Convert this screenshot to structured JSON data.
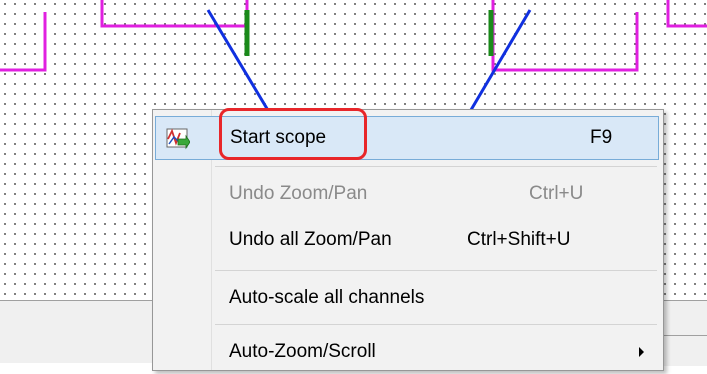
{
  "menu": {
    "items": [
      {
        "label": "Start scope",
        "shortcut": "F9",
        "enabled": true,
        "highlighted": true,
        "icon": "scope-start-icon"
      },
      {
        "label": "Undo Zoom/Pan",
        "shortcut": "Ctrl+U",
        "enabled": false
      },
      {
        "label": "Undo all Zoom/Pan",
        "shortcut": "Ctrl+Shift+U",
        "enabled": true
      },
      {
        "label": "Auto-scale all channels",
        "shortcut": "",
        "enabled": true
      },
      {
        "label": "Auto-Zoom/Scroll",
        "shortcut": "",
        "enabled": true,
        "submenu": true
      }
    ]
  },
  "colors": {
    "trace_magenta": "#e020e0",
    "trace_blue": "#1030e0",
    "trace_green": "#1a8a1a",
    "highlight_bg": "#d9e8f7",
    "highlight_border": "#78acd8",
    "callout_red": "#e8262a"
  }
}
